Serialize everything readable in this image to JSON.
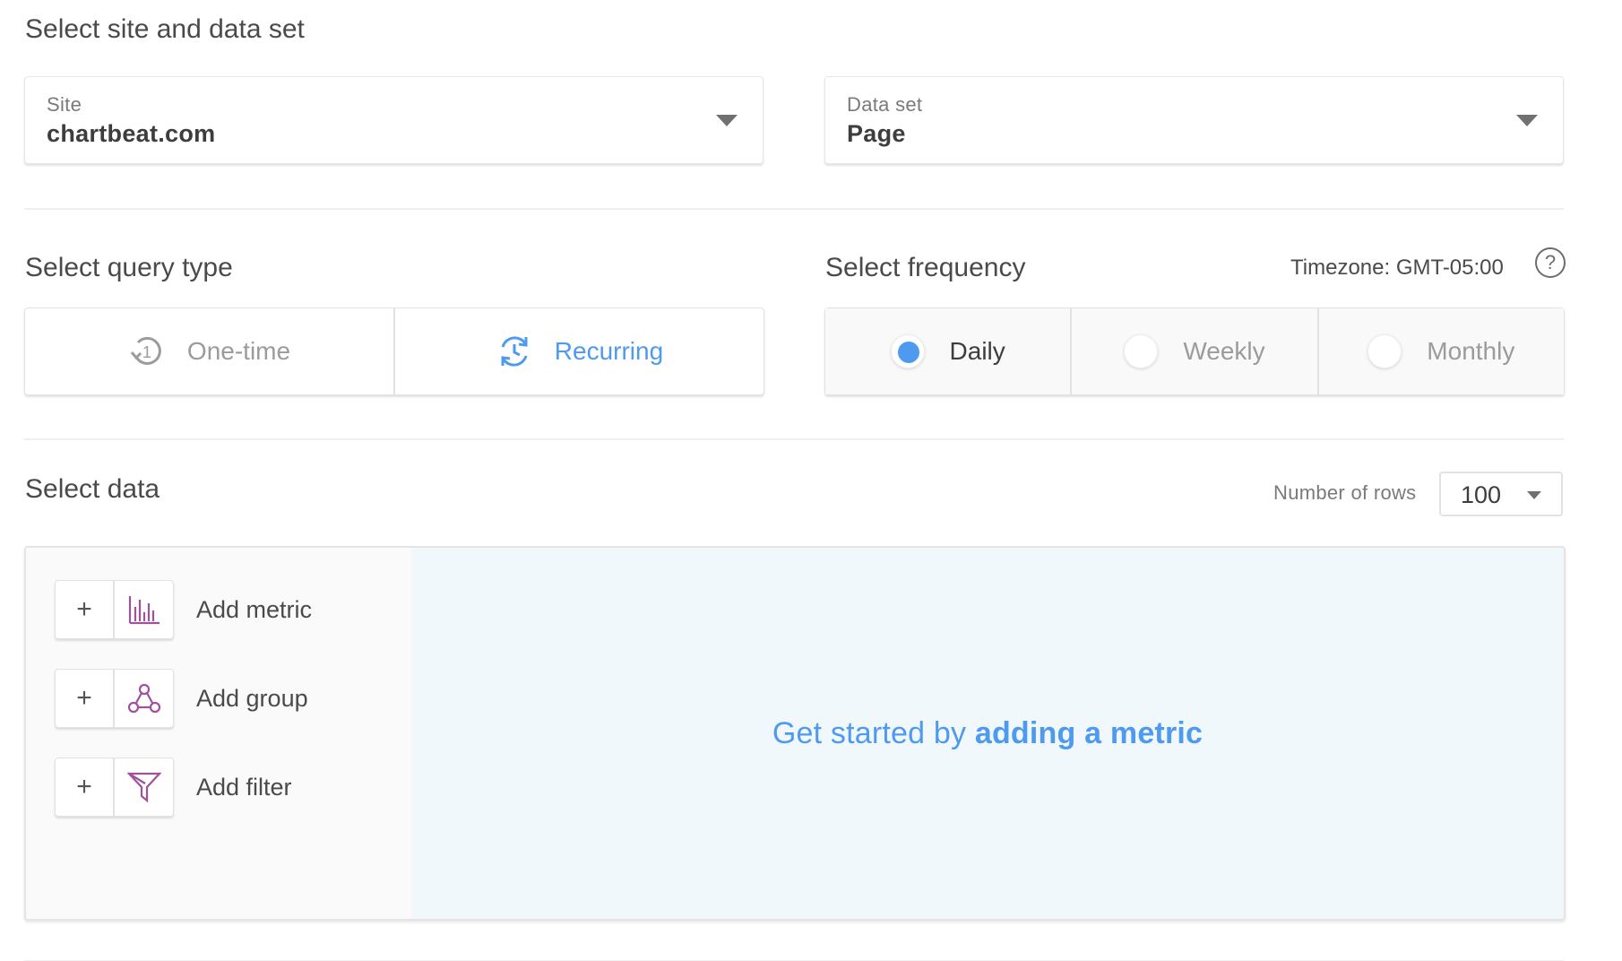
{
  "site_section": {
    "title": "Select site and data set",
    "site": {
      "label": "Site",
      "value": "chartbeat.com"
    },
    "dataset": {
      "label": "Data set",
      "value": "Page"
    }
  },
  "query_type": {
    "title": "Select query type",
    "options": [
      {
        "label": "One-time",
        "icon": "one-time-icon",
        "selected": false
      },
      {
        "label": "Recurring",
        "icon": "recurring-icon",
        "selected": true
      }
    ]
  },
  "frequency": {
    "title": "Select frequency",
    "timezone": "Timezone: GMT-05:00",
    "help_glyph": "?",
    "options": [
      {
        "label": "Daily",
        "selected": true
      },
      {
        "label": "Weekly",
        "selected": false
      },
      {
        "label": "Monthly",
        "selected": false
      }
    ]
  },
  "select_data": {
    "title": "Select data",
    "rows_label": "Number of rows",
    "rows_value": "100",
    "actions": [
      {
        "plus": "+",
        "label": "Add metric",
        "icon": "bar-chart-icon"
      },
      {
        "plus": "+",
        "label": "Add group",
        "icon": "group-nodes-icon"
      },
      {
        "plus": "+",
        "label": "Add filter",
        "icon": "funnel-icon"
      }
    ],
    "cta_prefix": "Get started by",
    "cta_link": "adding a metric"
  },
  "colors": {
    "accent": "#4e9af1",
    "icon_purple": "#a0519b",
    "inactive_text": "#9b9b9b"
  }
}
